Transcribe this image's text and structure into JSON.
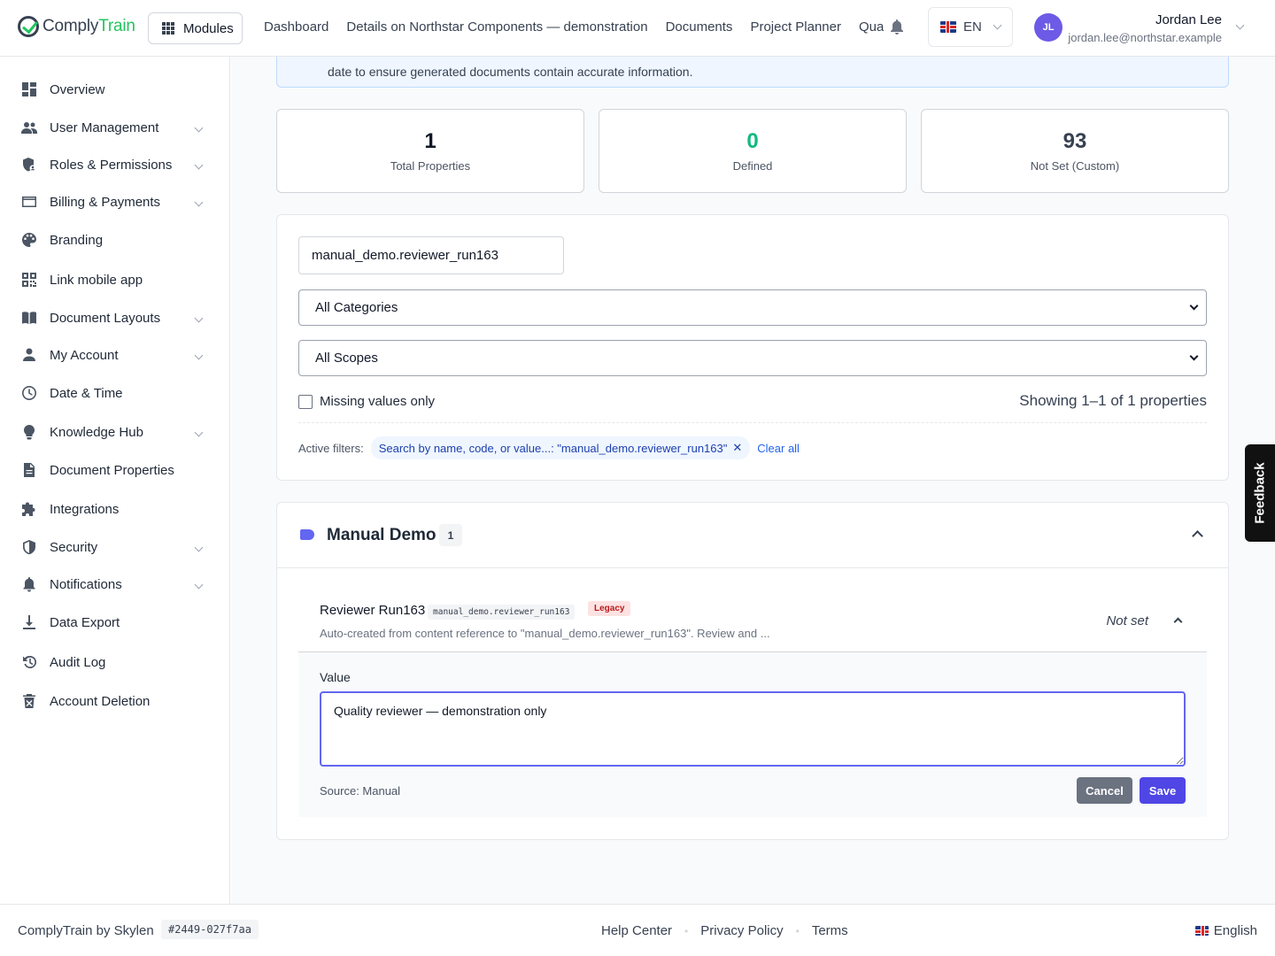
{
  "app": {
    "logo_prefix": "Comply",
    "logo_accent": "Train",
    "brand_color": "#22c55e"
  },
  "header": {
    "modules_label": "Modules",
    "nav": [
      "Dashboard",
      "Details on Northstar Components — demonstration",
      "Documents",
      "Project Planner",
      "Quali"
    ],
    "language": "EN",
    "user": {
      "initials": "JL",
      "name": "Jordan Lee",
      "email": "jordan.lee@northstar.example"
    }
  },
  "sidebar": {
    "items": [
      {
        "label": "Overview",
        "icon": "dashboard-icon",
        "expandable": false
      },
      {
        "label": "User Management",
        "icon": "users-icon",
        "expandable": true
      },
      {
        "label": "Roles & Permissions",
        "icon": "shield-user-icon",
        "expandable": true
      },
      {
        "label": "Billing & Payments",
        "icon": "credit-card-icon",
        "expandable": true
      },
      {
        "label": "Branding",
        "icon": "palette-icon",
        "expandable": false
      },
      {
        "label": "Link mobile app",
        "icon": "qr-code-icon",
        "expandable": false
      },
      {
        "label": "Document Layouts",
        "icon": "book-icon",
        "expandable": true
      },
      {
        "label": "My Account",
        "icon": "person-icon",
        "expandable": true
      },
      {
        "label": "Date & Time",
        "icon": "clock-icon",
        "expandable": false
      },
      {
        "label": "Knowledge Hub",
        "icon": "lightbulb-icon",
        "expandable": true
      },
      {
        "label": "Document Properties",
        "icon": "document-icon",
        "expandable": false
      },
      {
        "label": "Integrations",
        "icon": "puzzle-icon",
        "expandable": false
      },
      {
        "label": "Security",
        "icon": "shield-icon",
        "expandable": true
      },
      {
        "label": "Notifications",
        "icon": "bell-icon",
        "expandable": true
      },
      {
        "label": "Data Export",
        "icon": "download-icon",
        "expandable": false
      },
      {
        "label": "Audit Log",
        "icon": "history-icon",
        "expandable": false
      },
      {
        "label": "Account Deletion",
        "icon": "trash-icon",
        "expandable": false
      }
    ]
  },
  "main": {
    "banner_text": "date to ensure generated documents contain accurate information.",
    "stats": [
      {
        "value": "1",
        "label": "Total Properties"
      },
      {
        "value": "0",
        "label": "Defined"
      },
      {
        "value": "93",
        "label": "Not Set (Custom)"
      }
    ],
    "filters": {
      "search_value": "manual_demo.reviewer_run163",
      "category_select": "All Categories",
      "scope_select": "All Scopes",
      "missing_only_label": "Missing values only",
      "missing_only_checked": false,
      "showing_text": "Showing 1–1 of 1 properties",
      "active_filters_label": "Active filters:",
      "active_chip": "Search by name, code, or value...: \"manual_demo.reviewer_run163\"",
      "clear_all": "Clear all"
    },
    "group": {
      "title": "Manual Demo",
      "count": "1",
      "property": {
        "name": "Reviewer Run163",
        "code": "manual_demo.reviewer_run163",
        "badge": "Legacy",
        "description": "Auto-created from content reference to \"manual_demo.reviewer_run163\". Review and ...",
        "status": "Not set",
        "value_label": "Value",
        "value": "Quality reviewer — demonstration only",
        "source": "Source: Manual",
        "cancel_label": "Cancel",
        "save_label": "Save"
      }
    }
  },
  "feedback_label": "Feedback",
  "footer": {
    "brand": "ComplyTrain by Skylen",
    "build_hash": "#2449-027f7aa",
    "links": [
      "Help Center",
      "Privacy Policy",
      "Terms"
    ],
    "language": "English"
  }
}
